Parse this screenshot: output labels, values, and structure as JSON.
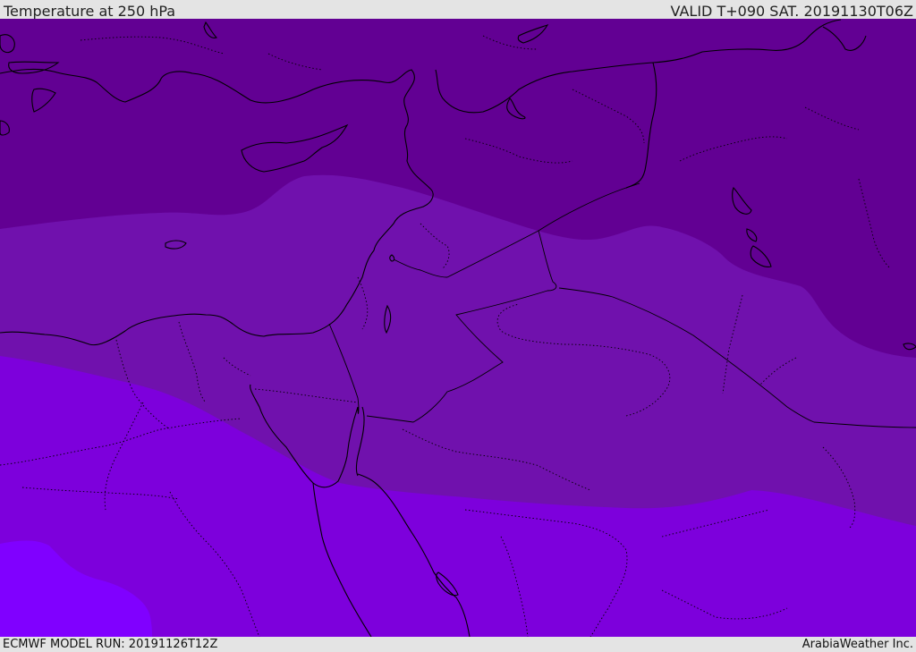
{
  "header": {
    "title": "Temperature at 250 hPa",
    "valid": "VALID T+090 SAT. 20191130T06Z"
  },
  "footer": {
    "model_run": "ECMWF MODEL RUN: 20191126T12Z",
    "credit": "ArabiaWeather Inc."
  },
  "colors": {
    "band_coldest": "#620093",
    "band_cold": "#7011ad",
    "band_mid": "#7d00dc",
    "band_warm": "#8000ff",
    "coastline": "#000000",
    "header_bg": "#e4e4e4"
  }
}
